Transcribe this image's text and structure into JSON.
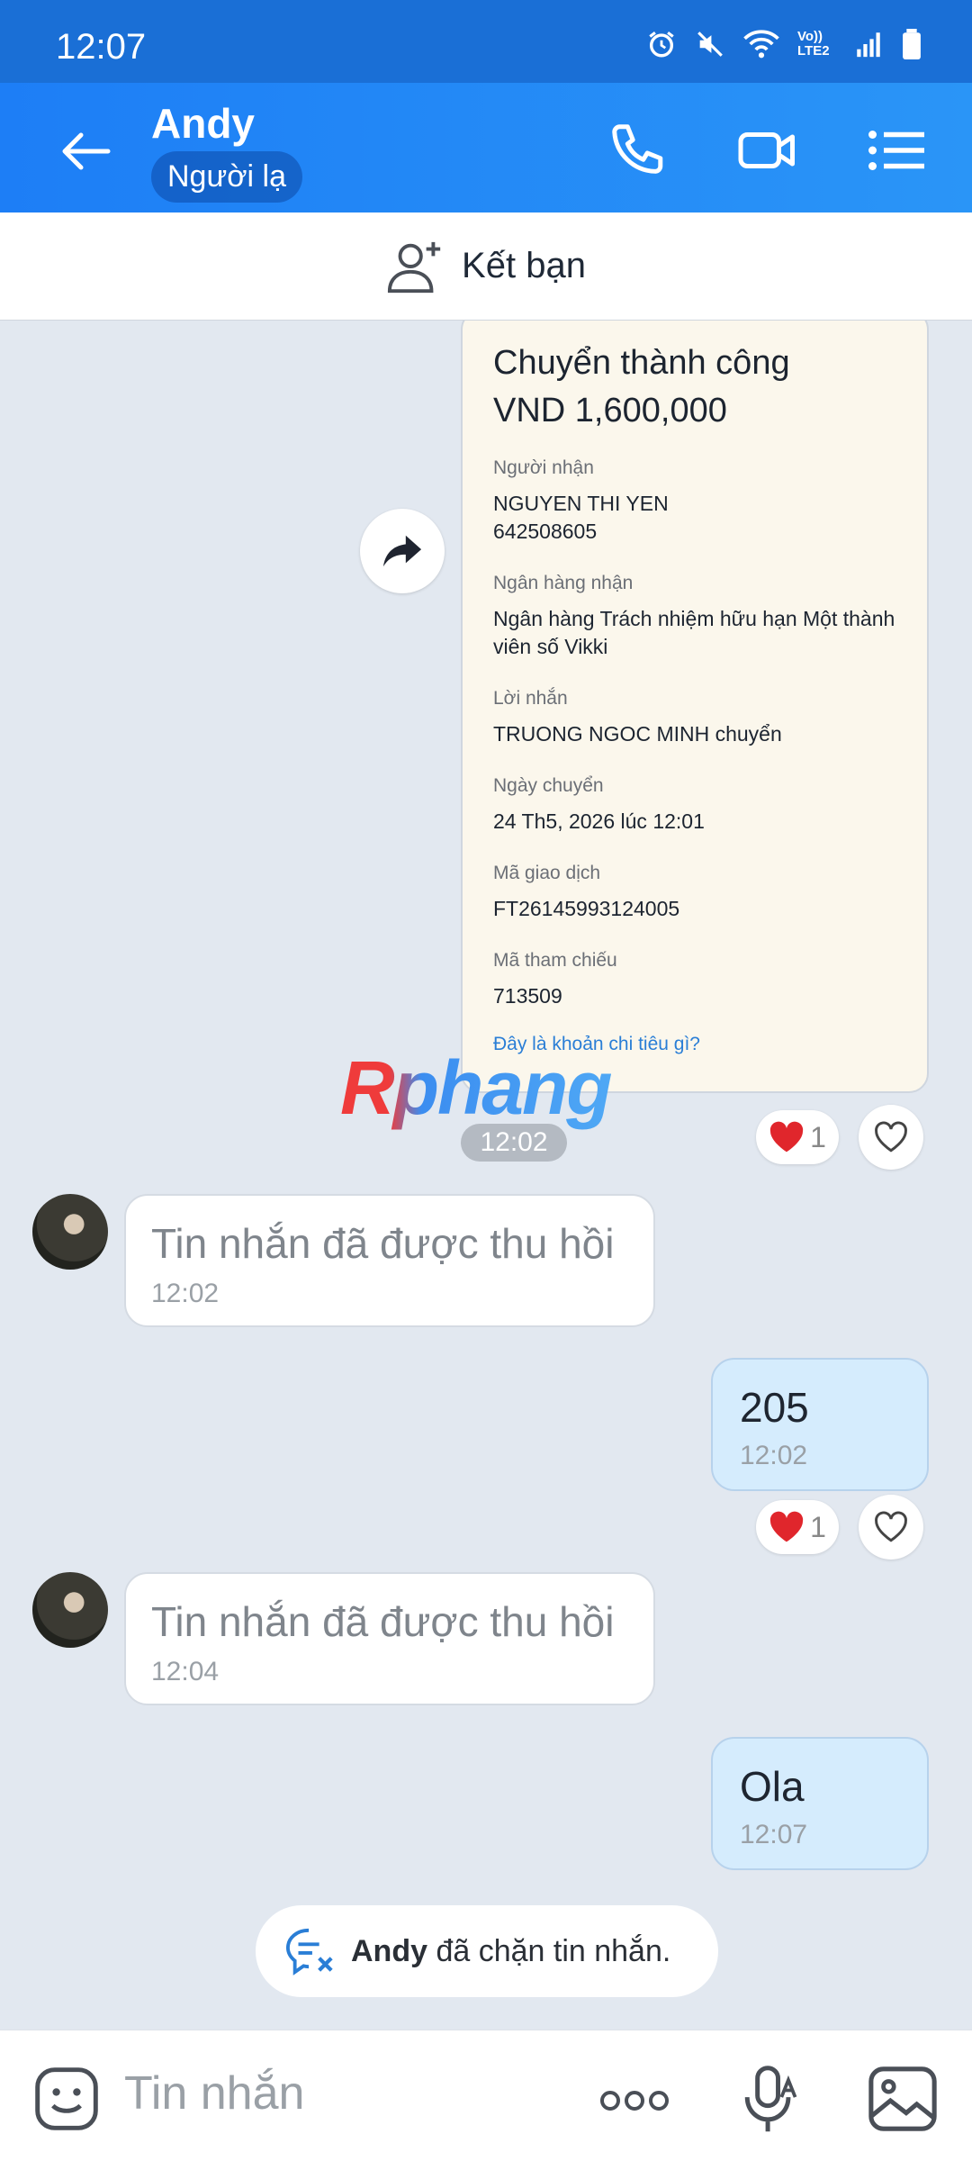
{
  "status_bar": {
    "time": "12:07",
    "network_label": "Vo)) LTE2"
  },
  "header": {
    "contact_name": "Andy",
    "badge": "Người lạ"
  },
  "add_friend": {
    "label": "Kết bạn"
  },
  "receipt": {
    "title": "Chuyển thành công",
    "amount": "VND 1,600,000",
    "fields": [
      {
        "label": "Người nhận",
        "value": "NGUYEN THI YEN\n642508605"
      },
      {
        "label": "Ngân hàng nhận",
        "value": "Ngân hàng Trách nhiệm hữu hạn Một thành viên số Vikki"
      },
      {
        "label": "Lời nhắn",
        "value": "TRUONG NGOC MINH chuyển"
      },
      {
        "label": "Ngày chuyển",
        "value": "24 Th5, 2026 lúc 12:01"
      },
      {
        "label": "Mã giao dịch",
        "value": "FT26145993124005"
      },
      {
        "label": "Mã tham chiếu",
        "value": "713509"
      }
    ],
    "link": "Đây là khoản chi tiêu gì?"
  },
  "watermark": "Rphang",
  "reactions": {
    "receipt_count": "1",
    "msg205_count": "1"
  },
  "time_chip": "12:02",
  "messages": [
    {
      "text": "Tin nhắn đã được thu hồi",
      "time": "12:02"
    },
    {
      "text": "205",
      "time": "12:02"
    },
    {
      "text": "Tin nhắn đã được thu hồi",
      "time": "12:04"
    },
    {
      "text": "Ola",
      "time": "12:07"
    }
  ],
  "blocked_notice": {
    "name": "Andy",
    "text": " đã chặn tin nhắn."
  },
  "input": {
    "placeholder": "Tin nhắn"
  },
  "colors": {
    "header": "#1d7ef6",
    "outgoing_bubble": "#d5ecfd",
    "chat_bg": "#e2e8f0",
    "heart": "#e0262c"
  },
  "icons": [
    "back-arrow-icon",
    "phone-icon",
    "video-call-icon",
    "menu-icon",
    "add-friend-icon",
    "share-icon",
    "heart-icon",
    "heart-outline-icon",
    "blocked-chat-icon",
    "emoji-icon",
    "more-icon",
    "mic-icon",
    "gallery-icon"
  ]
}
